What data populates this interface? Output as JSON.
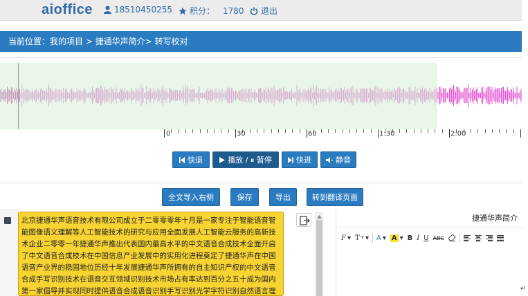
{
  "header": {
    "logo": "aioffice",
    "user_id": "18510450255",
    "points_label": "积分：",
    "points_value": "1780",
    "logout_label": "退出"
  },
  "breadcrumb": {
    "text": "当前位置：我的项目 > 捷通华声简介> 转写校对"
  },
  "waveform": {
    "played_color": "#e8f6e8",
    "played_wave_color": "#d9b3d4",
    "unplayed_wave_color": "#e655d4",
    "time_labels": [
      "0",
      "30",
      "60",
      "1:30",
      "2:00"
    ]
  },
  "playback": {
    "rewind_label": "快退",
    "play_pause_label": "播放 / ⏸ 暂停",
    "forward_label": "快进",
    "mute_label": "静音"
  },
  "actions": {
    "import_right": "全文导入右侧",
    "save": "保存",
    "export": "导出",
    "to_translate": "转到翻译页面"
  },
  "transcript": {
    "text": "北京捷通华声语音技术有限公司成立于二零零零年十月是一家专注于智能语音智能图像语义理解等人工智能技术的研究与应用全面发展人工智能云服务的高新技术企业二零零一年捷通华声推出代表国内最高水平的中文语音合成技术全面开启了中文语音合成技术在中国信息产业发展中的实用化进程奠定了捷通华声在中国语音产业界的稳固地位历经十年发展捷通华声所拥有的自主知识产权的中文语音合成手写识别技术在语音交互领域识别技术市场占有率达到百分之五十成为国内第一家倡导并实现同时提供语音合成语音识别手写识别光学字符识别自然语言理解等技术的全方位人工智能技术提供商二零一一年伴随人工智能技术的进步与云计算技术的高速发展捷通华声推出了全球首个全方位人工智能开放平台灵云平台hcicloud点按视语音交互图像识别语义理解生物特征"
  },
  "editor": {
    "title": "捷通华声简介",
    "toolbar": [
      "F",
      "T",
      "A",
      "A",
      "B",
      "I",
      "U",
      "ABC"
    ]
  },
  "corner_glyph": "↵"
}
